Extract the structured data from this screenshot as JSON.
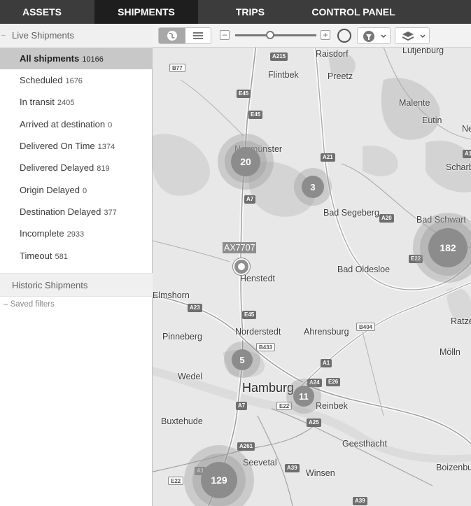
{
  "nav": {
    "tabs": [
      {
        "label": "ASSETS"
      },
      {
        "label": "SHIPMENTS"
      },
      {
        "label": "TRIPS"
      },
      {
        "label": "CONTROL PANEL"
      }
    ]
  },
  "sidebar": {
    "live_title": "Live Shipments",
    "items": [
      {
        "label": "All shipments",
        "count": "10166"
      },
      {
        "label": "Scheduled",
        "count": "1676"
      },
      {
        "label": "In transit",
        "count": "2405"
      },
      {
        "label": "Arrived at destination",
        "count": "0"
      },
      {
        "label": "Delivered On Time",
        "count": "1374"
      },
      {
        "label": "Delivered Delayed",
        "count": "819"
      },
      {
        "label": "Origin Delayed",
        "count": "0"
      },
      {
        "label": "Destination Delayed",
        "count": "377"
      },
      {
        "label": "Incomplete",
        "count": "2933"
      },
      {
        "label": "Timeout",
        "count": "581"
      }
    ],
    "historic_title": "Historic Shipments",
    "saved_filters": "Saved filters"
  },
  "map": {
    "places": {
      "raisdorf": "Raisdorf",
      "lutjenburg": "Lutjenburg",
      "flintbek": "Flintbek",
      "preetz": "Preetz",
      "malente": "Malente",
      "eutin": "Eutin",
      "scharb": "Scharb",
      "ne": "Ne",
      "neumunster": "Neumünster",
      "bad_segeberg": "Bad Segeberg",
      "bad_schwartau": "Bad Schwart",
      "bad_oldesloe": "Bad Oldesloe",
      "henstedt": "Henstedt",
      "elmshorn": "Elmshorn",
      "norderstedt": "Norderstedt",
      "ahrensburg": "Ahrensburg",
      "pinneberg": "Pinneberg",
      "ratze": "Ratze",
      "wedel": "Wedel",
      "molln": "Mölln",
      "hamburg": "Hamburg",
      "reinbek": "Reinbek",
      "buxtehude": "Buxtehude",
      "geesthacht": "Geesthacht",
      "seevetal": "Seevetal",
      "winsen": "Winsen",
      "boizenburg": "Boizenbu"
    },
    "shields": [
      "B77",
      "A215",
      "E45",
      "E45",
      "A21",
      "A7",
      "A20",
      "E22",
      "A23",
      "E45",
      "B404",
      "B433",
      "A1",
      "A24",
      "E26",
      "A7",
      "E22",
      "A25",
      "A261",
      "A39",
      "A1",
      "E22",
      "A39",
      "A1"
    ],
    "clusters": [
      {
        "count": "20"
      },
      {
        "count": "3"
      },
      {
        "count": "182"
      },
      {
        "count": "5"
      },
      {
        "count": "11"
      },
      {
        "count": "129"
      }
    ],
    "vehicle_label": "AX7707"
  },
  "colors": {
    "nav_bg": "#3c3c3c",
    "nav_active": "#1e1e1e",
    "selected": "#c8c8c8",
    "cluster": "#8c8c8c"
  }
}
